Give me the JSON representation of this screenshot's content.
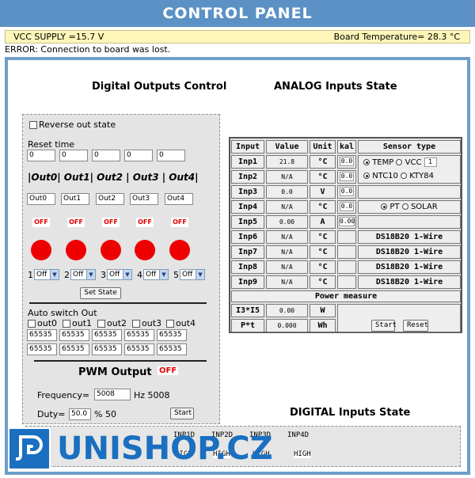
{
  "header": {
    "title": "CONTROL PANEL"
  },
  "status": {
    "vcc": "VCC SUPPLY =15.7 V",
    "board_temp": "Board Temperature= 28.3 °C",
    "error": "ERROR: Connection to board was lost."
  },
  "digital_outputs": {
    "title": "Digital Outputs Control",
    "reverse_label": "Reverse out state",
    "reset_time_label": "Reset time",
    "reset_times": [
      "0",
      "0",
      "0",
      "0",
      "0"
    ],
    "header_line": "|Out0| Out1| Out2 | Out3 | Out4|",
    "names": [
      "Out0",
      "Out1",
      "Out2",
      "Out3",
      "Out4"
    ],
    "states": [
      "OFF",
      "OFF",
      "OFF",
      "OFF",
      "OFF"
    ],
    "selector_numbers": [
      "1",
      "2",
      "3",
      "4",
      "5"
    ],
    "selector_values": [
      "Off",
      "Off",
      "Off",
      "Off",
      "Off"
    ],
    "set_state_label": "Set State",
    "auto_switch_label": "Auto switch Out",
    "auto_checks": [
      "out0",
      "out1",
      "out2",
      "out3",
      "out4"
    ],
    "auto_row1": [
      "65535",
      "65535",
      "65535",
      "65535",
      "65535"
    ],
    "auto_row2": [
      "65535",
      "65535",
      "65535",
      "65535",
      "65535"
    ]
  },
  "pwm": {
    "title": "PWM Output",
    "state": "OFF",
    "freq_label": "Frequency=",
    "freq_value": "5008",
    "freq_unit": "Hz 5008",
    "duty_label": "Duty=",
    "duty_value": "50.0",
    "duty_unit": "% 50",
    "start_label": "Start"
  },
  "analog": {
    "title": "ANALOG Inputs State",
    "headers": [
      "Input",
      "Value",
      "Unit",
      "kal",
      "Sensor type"
    ],
    "rows": [
      {
        "input": "Inp1",
        "value": "21.8",
        "unit": "°C",
        "kal": "0.0"
      },
      {
        "input": "Inp2",
        "value": "N/A",
        "unit": "°C",
        "kal": "0.0"
      },
      {
        "input": "Inp3",
        "value": "0.0",
        "unit": "V",
        "kal": "0.0"
      },
      {
        "input": "Inp4",
        "value": "N/A",
        "unit": "°C",
        "kal": "0.0"
      },
      {
        "input": "Inp5",
        "value": "0.00",
        "unit": "A",
        "kal": "0.00"
      },
      {
        "input": "Inp6",
        "value": "N/A",
        "unit": "°C",
        "sensor": "DS18B20 1-Wire"
      },
      {
        "input": "Inp7",
        "value": "N/A",
        "unit": "°C",
        "sensor": "DS18B20 1-Wire"
      },
      {
        "input": "Inp8",
        "value": "N/A",
        "unit": "°C",
        "sensor": "DS18B20 1-Wire"
      },
      {
        "input": "Inp9",
        "value": "N/A",
        "unit": "°C",
        "sensor": "DS18B20 1-Wire"
      }
    ],
    "sensor_options": {
      "temp": "TEMP",
      "vcc": "VCC",
      "vcc_box": "1",
      "ntc": "NTC10",
      "kty": "KTY84",
      "pt": "PT",
      "solar": "SOLAR"
    },
    "power_label": "Power measure",
    "power_rows": [
      {
        "label": "I3*I5",
        "value": "0.00",
        "unit": "W"
      },
      {
        "label": "P*t",
        "value": "0.000",
        "unit": "Wh"
      }
    ],
    "start_label": "Start",
    "reset_label": "Reset"
  },
  "digital_inputs": {
    "title": "DIGITAL Inputs State",
    "labels": [
      "INP1D",
      "INP2D",
      "INP3D",
      "INP4D"
    ],
    "states": [
      "HIGH",
      "HIGH",
      "HIGH",
      "HIGH"
    ]
  },
  "logo": {
    "text": "UNISHOP.CZ"
  },
  "colors": {
    "header": "#5b91c4",
    "frame": "#6f9ec9",
    "off": "#e00000",
    "logo": "#1b6fc0"
  }
}
